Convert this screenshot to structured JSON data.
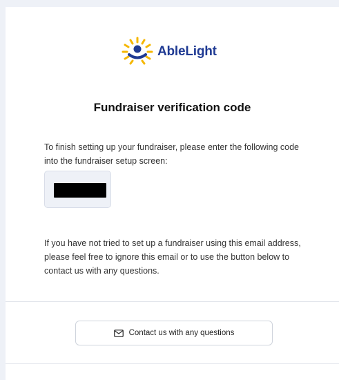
{
  "brand": {
    "name": "AbleLight",
    "primary_color": "#1f3a93",
    "accent_color": "#f5b700"
  },
  "email": {
    "title": "Fundraiser verification code",
    "intro": "To finish setting up your fundraiser, please enter the following code into the fundraiser setup screen:",
    "code": "",
    "note": "If you have not tried to set up a fundraiser using this email address, please feel free to ignore this email or to use the button below to contact us with any questions.",
    "contact_button": {
      "label": "Contact us with any questions",
      "icon": "mail-icon"
    }
  }
}
